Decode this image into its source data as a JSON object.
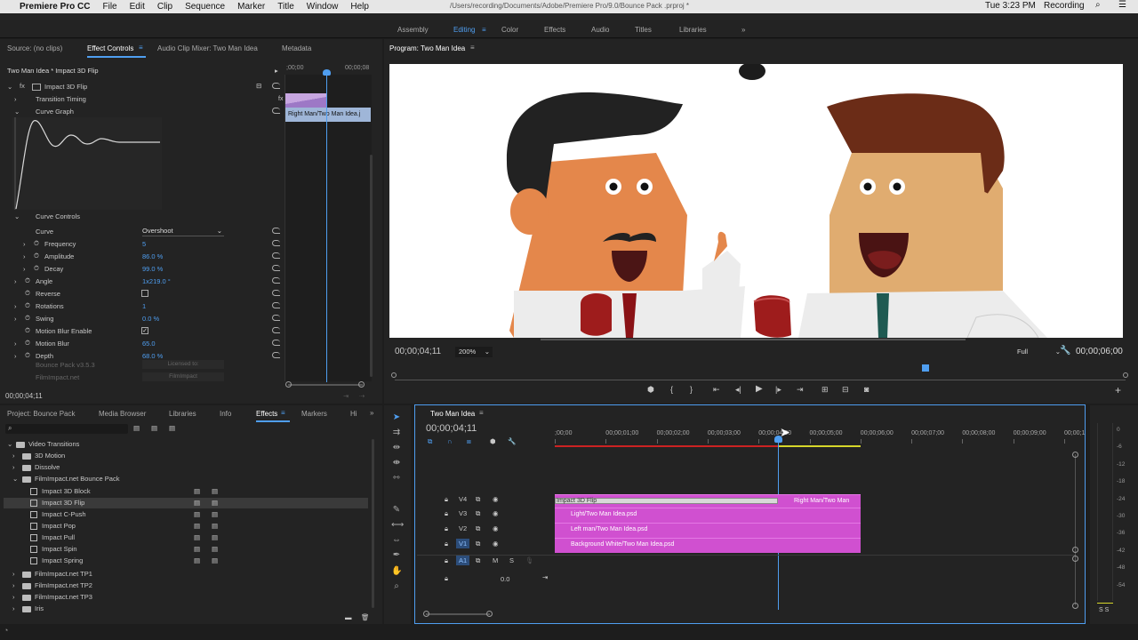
{
  "menubar": {
    "app": "Premiere Pro CC",
    "items": [
      "File",
      "Edit",
      "Clip",
      "Sequence",
      "Marker",
      "Title",
      "Window",
      "Help"
    ],
    "path": "/Users/recording/Documents/Adobe/Premiere Pro/9.0/Bounce Pack .prproj *",
    "clock": "Tue 3:23 PM",
    "user": "Recording"
  },
  "workspaces": [
    "Assembly",
    "Editing",
    "Color",
    "Effects",
    "Audio",
    "Titles",
    "Libraries"
  ],
  "source_tabs": [
    "Source: (no clips)",
    "Effect Controls",
    "Audio Clip Mixer: Two Man Idea",
    "Metadata"
  ],
  "effect_controls": {
    "clip_name": "Two Man Idea * Impact 3D Flip",
    "mini_tc_start": ";00;00",
    "mini_tc_end": "00;00;08",
    "mini_clip": "Right Man/Two Man Idea.j",
    "effect": "Impact 3D Flip",
    "transition_timing": "Transition Timing",
    "curve_graph": "Curve Graph",
    "curve_controls": "Curve Controls",
    "params": [
      {
        "label": "Curve",
        "value": "Overshoot"
      },
      {
        "label": "Frequency",
        "value": "5"
      },
      {
        "label": "Amplitude",
        "value": "86.0 %"
      },
      {
        "label": "Decay",
        "value": "99.0 %"
      },
      {
        "label": "Angle",
        "value": "1x219.0 °"
      },
      {
        "label": "Reverse",
        "value": ""
      },
      {
        "label": "Rotations",
        "value": "1"
      },
      {
        "label": "Swing",
        "value": "0.0 %"
      },
      {
        "label": "Motion Blur Enable",
        "value": ""
      },
      {
        "label": "Motion Blur",
        "value": "65.0"
      },
      {
        "label": "Depth",
        "value": "68.0 %"
      }
    ],
    "footer1": "Bounce Pack v3.5.3",
    "footer1_btn": "Licensed to:",
    "footer2": "FilmImpact.net",
    "footer2_btn": "FilmImpact",
    "timecode": "00;00;04;11"
  },
  "program": {
    "title": "Program: Two Man Idea",
    "timecode": "00;00;04;11",
    "zoom": "200%",
    "quality": "Full",
    "duration": "00;00;06;00"
  },
  "project_tabs": [
    "Project: Bounce Pack",
    "Media Browser",
    "Libraries",
    "Info",
    "Effects",
    "Markers",
    "Hi"
  ],
  "effects_tree": {
    "root": "Video Transitions",
    "folders": [
      "3D Motion",
      "Dissolve",
      "FilmImpact.net Bounce Pack"
    ],
    "items": [
      "Impact 3D Block",
      "Impact 3D Flip",
      "Impact C-Push",
      "Impact Pop",
      "Impact Pull",
      "Impact Spin",
      "Impact Spring"
    ],
    "more": [
      "FilmImpact.net TP1",
      "FilmImpact.net TP2",
      "FilmImpact.net TP3",
      "Iris"
    ]
  },
  "timeline": {
    "title": "Two Man Idea",
    "timecode": "00;00;04;11",
    "ruler": [
      ";00;00",
      "00;00;01;00",
      "00;00;02;00",
      "00;00;03;00",
      "00;00;04;00",
      "00;00;05;00",
      "00;00;06;00",
      "00;00;07;00",
      "00;00;08;00",
      "00;00;09;00",
      "00;00;1"
    ],
    "tracks": [
      "V4",
      "V3",
      "V2",
      "V1",
      "A1"
    ],
    "audio_m": "M",
    "audio_s": "S",
    "audio_level": "0.0",
    "clips": [
      "Impact 3D Flip",
      "Right Man/Two Man",
      "Light/Two Man Idea.psd",
      "Left man/Two Man Idea.psd",
      "Background White/Two Man Idea.psd"
    ],
    "meter": [
      "0",
      "-6",
      "-12",
      "-18",
      "-24",
      "-30",
      "-36",
      "-42",
      "-48",
      "-54"
    ],
    "meter_ss": "S S"
  },
  "colors": {
    "accent": "#4f9ef0",
    "clip": "#d050d0",
    "panel": "#232323"
  }
}
